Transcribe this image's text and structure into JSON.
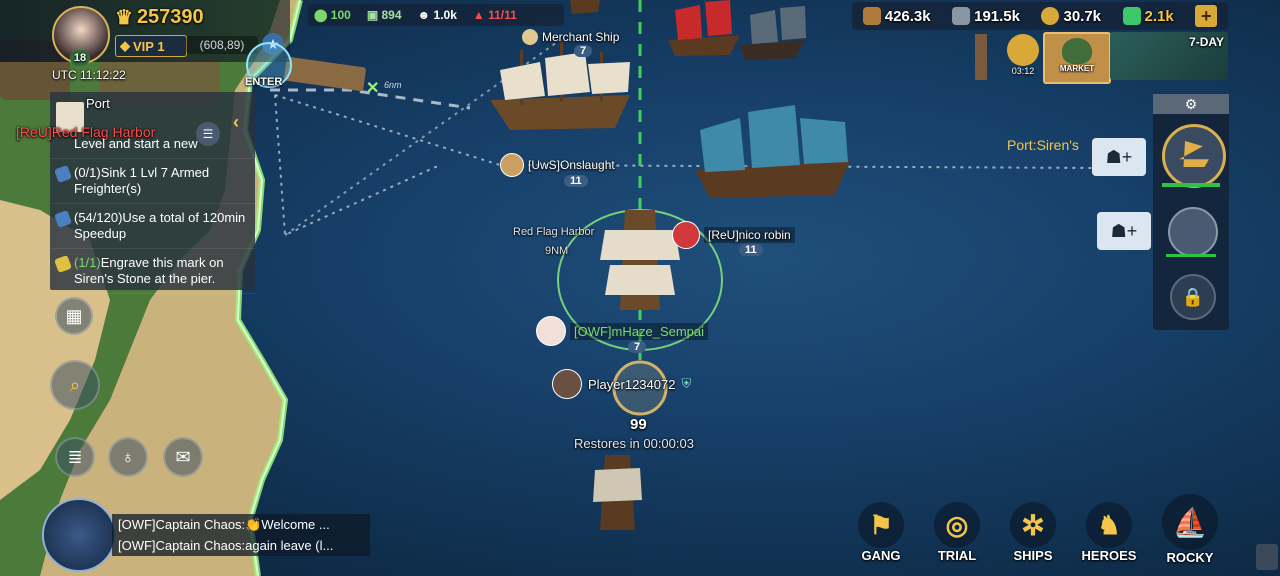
{
  "player": {
    "level": "18",
    "power": "257390",
    "vip": "VIP 1",
    "coords": "(608,89)",
    "utc_time": "UTC 11:12:22"
  },
  "top_stats": {
    "stamina": "100",
    "troops": "894",
    "population": "1.0k",
    "fleet_count": "11/11"
  },
  "resources": {
    "wood": "426.3k",
    "iron": "191.5k",
    "gold": "30.7k",
    "gems": "2.1k"
  },
  "top_right": {
    "timer": "03:12",
    "market_label": "MARKET",
    "event_label": "7-DAY"
  },
  "map": {
    "enter_label": "ENTER",
    "merchant_ship": {
      "name": "Merchant Ship",
      "level": "7"
    },
    "onslaught": {
      "name": "[UwS]Onslaught",
      "level": "11"
    },
    "port_siren": "Port:Siren's",
    "red_flag": {
      "name": "Red Flag Harbor",
      "dist": "9NM"
    },
    "nico": {
      "name": "[ReU]nico robin",
      "level": "11"
    },
    "mhaze": {
      "name": "[OWF]mHaze_Sempai",
      "level": "7"
    },
    "player_name": "Player1234072",
    "troop_count": "99",
    "restores": "Restores in 00:00:03",
    "route_label": "6nm"
  },
  "quest_panel": {
    "title": "Port",
    "port_tag": "[ReU]Red Flag Harbor",
    "items": [
      {
        "text": "Level and start a new"
      },
      {
        "text": "(0/1)Sink 1 Lvl 7 Armed Freighter(s)"
      },
      {
        "text": "(54/120)Use a total of 120min Speedup"
      },
      {
        "progress": "(1/1)",
        "text": "Engrave this mark on Siren's Stone at the pier."
      }
    ]
  },
  "chat": [
    "[OWF]Captain Chaos:👏Welcome ...",
    "[OWF]Captain Chaos:again leave (l..."
  ],
  "bottom_nav": [
    {
      "label": "GANG"
    },
    {
      "label": "TRIAL"
    },
    {
      "label": "SHIPS"
    },
    {
      "label": "HEROES"
    },
    {
      "label": "ROCKY"
    }
  ],
  "colors": {
    "sea": "#17406a",
    "gold": "#f3c64a",
    "green_text": "#7bd96b",
    "red_text": "#ff4a4a",
    "coast_glow": "#9cf27a"
  }
}
